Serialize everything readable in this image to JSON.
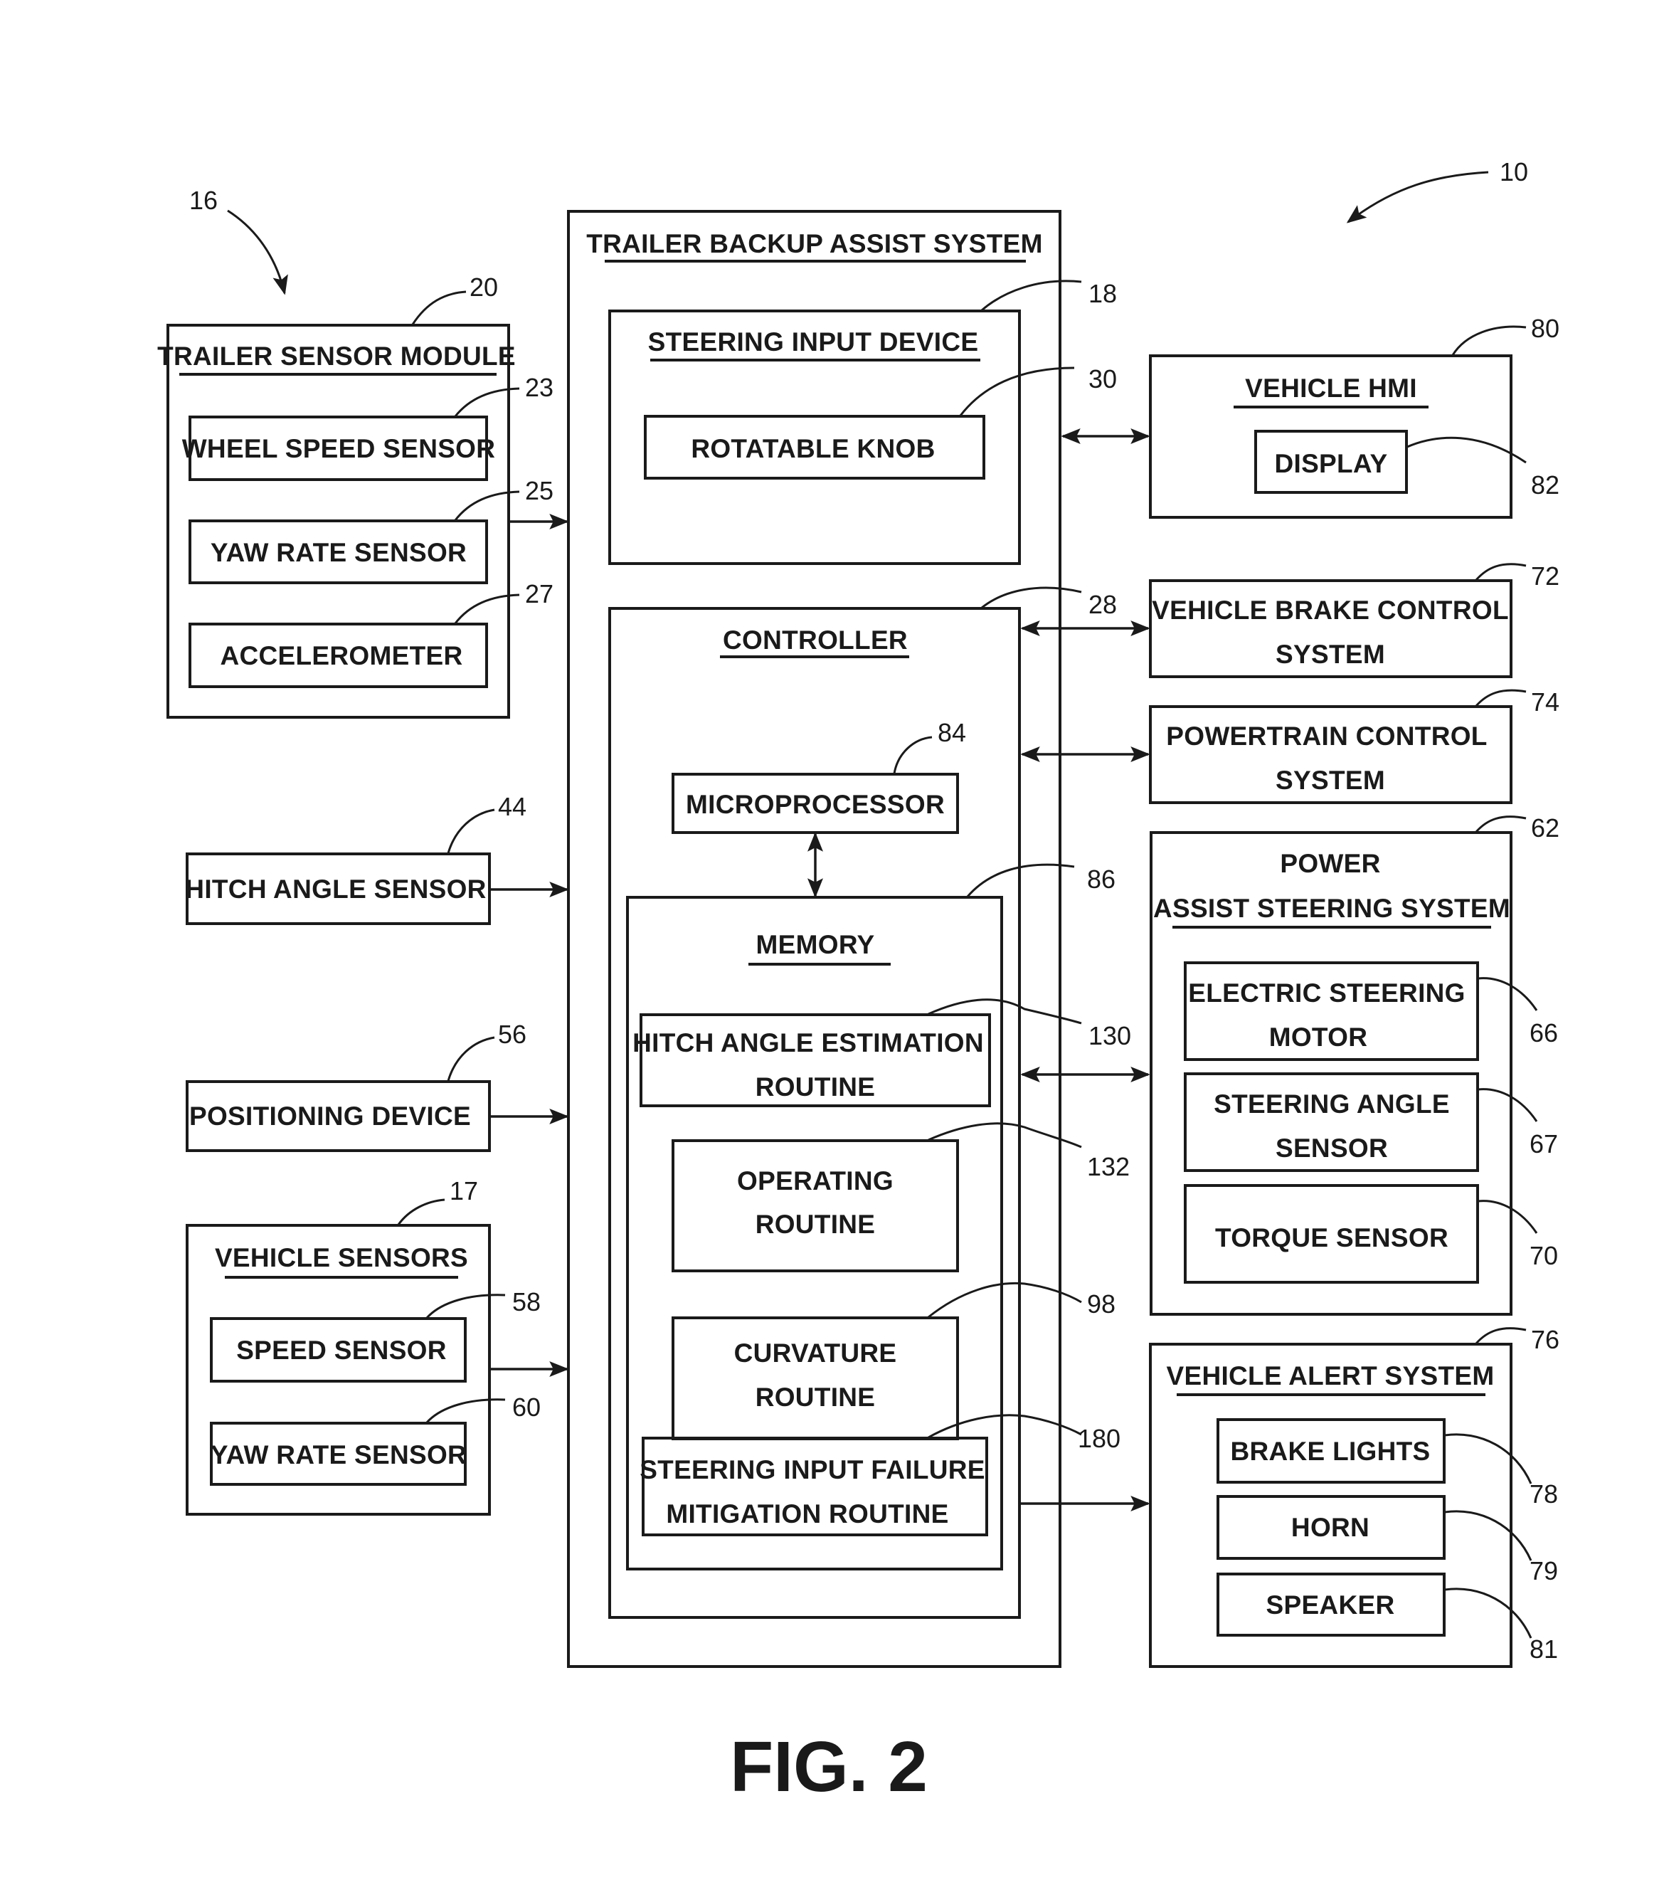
{
  "figure": {
    "caption": "FIG. 2",
    "system_ref": "10",
    "trailer_ref": "16"
  },
  "trailer_sensor_module": {
    "title": "TRAILER SENSOR MODULE",
    "ref": "20",
    "items": [
      {
        "label": "WHEEL SPEED SENSOR",
        "ref": "23"
      },
      {
        "label": "YAW RATE SENSOR",
        "ref": "25"
      },
      {
        "label": "ACCELEROMETER",
        "ref": "27"
      }
    ]
  },
  "hitch_angle_sensor": {
    "label": "HITCH ANGLE SENSOR",
    "ref": "44"
  },
  "positioning_device": {
    "label": "POSITIONING DEVICE",
    "ref": "56"
  },
  "vehicle_sensors": {
    "title": "VEHICLE SENSORS",
    "ref": "17",
    "items": [
      {
        "label": "SPEED SENSOR",
        "ref": "58"
      },
      {
        "label": "YAW RATE SENSOR",
        "ref": "60"
      }
    ]
  },
  "trailer_backup_assist_system": {
    "title": "TRAILER BACKUP ASSIST SYSTEM",
    "steering_input_device": {
      "title": "STEERING INPUT DEVICE",
      "ref": "18",
      "rotatable_knob": {
        "label": "ROTATABLE KNOB",
        "ref": "30"
      }
    },
    "controller": {
      "title": "CONTROLLER",
      "ref": "28",
      "microprocessor": {
        "label": "MICROPROCESSOR",
        "ref": "84"
      },
      "memory": {
        "title": "MEMORY",
        "ref": "86",
        "routines": [
          {
            "line1": "HITCH ANGLE ESTIMATION",
            "line2": "ROUTINE",
            "ref": "130"
          },
          {
            "line1": "OPERATING",
            "line2": "ROUTINE",
            "ref": "132"
          },
          {
            "line1": "CURVATURE",
            "line2": "ROUTINE",
            "ref": "98"
          },
          {
            "line1": "STEERING INPUT FAILURE",
            "line2": "MITIGATION ROUTINE",
            "ref": "180"
          }
        ]
      }
    }
  },
  "vehicle_hmi": {
    "title": "VEHICLE HMI",
    "ref": "80",
    "display": {
      "label": "DISPLAY",
      "ref": "82"
    }
  },
  "vehicle_brake_control_system": {
    "line1": "VEHICLE BRAKE CONTROL",
    "line2": "SYSTEM",
    "ref": "72"
  },
  "powertrain_control_system": {
    "line1": "POWERTRAIN CONTROL",
    "line2": "SYSTEM",
    "ref": "74"
  },
  "power_assist_steering_system": {
    "line1": "POWER",
    "line2": "ASSIST STEERING SYSTEM",
    "ref": "62",
    "items": [
      {
        "line1": "ELECTRIC STEERING",
        "line2": "MOTOR",
        "ref": "66"
      },
      {
        "line1": "STEERING ANGLE",
        "line2": "SENSOR",
        "ref": "67"
      },
      {
        "line1": "TORQUE SENSOR",
        "line2": "",
        "ref": "70"
      }
    ]
  },
  "vehicle_alert_system": {
    "title": "VEHICLE ALERT SYSTEM",
    "ref": "76",
    "items": [
      {
        "label": "BRAKE LIGHTS",
        "ref": "78"
      },
      {
        "label": "HORN",
        "ref": "79"
      },
      {
        "label": "SPEAKER",
        "ref": "81"
      }
    ]
  }
}
